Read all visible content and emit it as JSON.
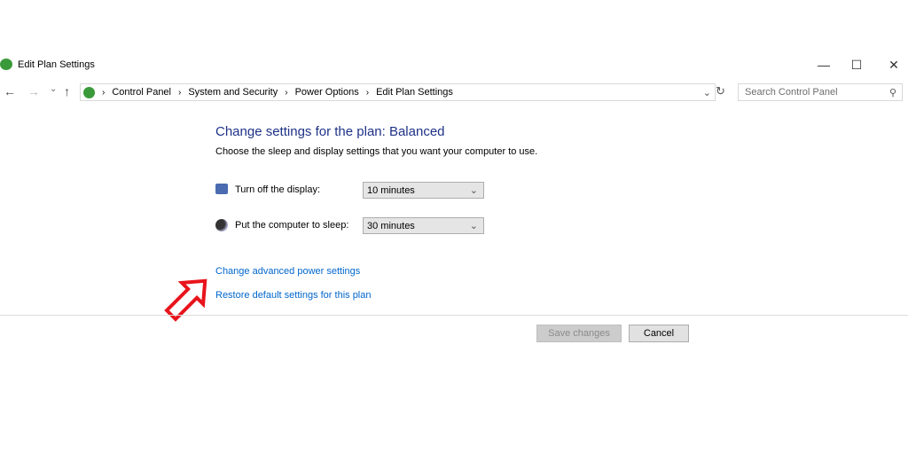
{
  "window": {
    "title": "Edit Plan Settings",
    "minimize": "—",
    "maximize": "☐",
    "close": "✕"
  },
  "nav": {
    "back": "←",
    "forward": "→",
    "recent": "⌄",
    "up": "↑",
    "refresh": "↻",
    "dropdown": "⌄"
  },
  "breadcrumb": [
    "Control Panel",
    "System and Security",
    "Power Options",
    "Edit Plan Settings"
  ],
  "search": {
    "placeholder": "Search Control Panel"
  },
  "main": {
    "heading": "Change settings for the plan: Balanced",
    "subtitle": "Choose the sleep and display settings that you want your computer to use.",
    "display": {
      "label": "Turn off the display:",
      "value": "10 minutes"
    },
    "sleep": {
      "label": "Put the computer to sleep:",
      "value": "30 minutes"
    },
    "links": [
      "Change advanced power settings",
      "Restore default settings for this plan"
    ]
  },
  "buttons": {
    "save": "Save changes",
    "cancel": "Cancel"
  },
  "colors": {
    "heading": "#1e3287",
    "link": "#0066cc",
    "arrow": "#e8141c"
  }
}
